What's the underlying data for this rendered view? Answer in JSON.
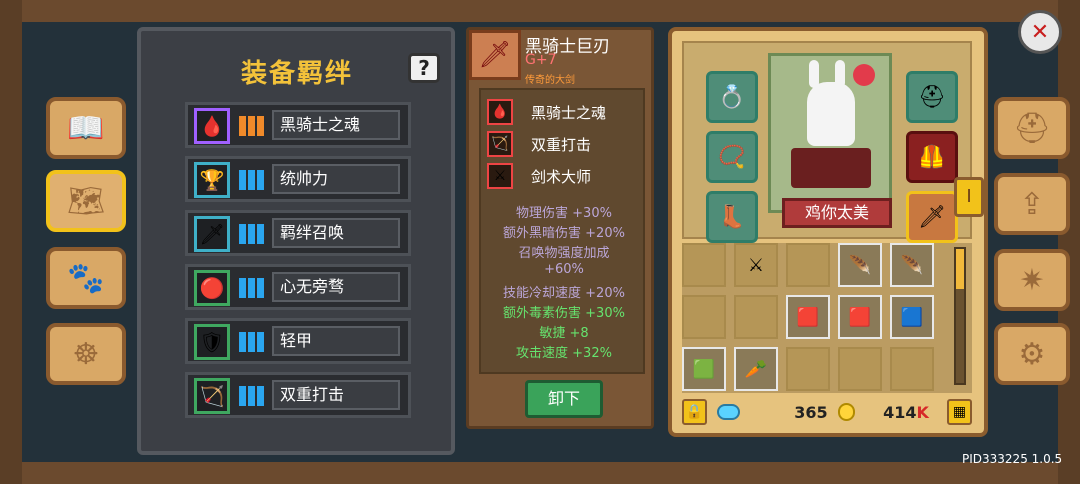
{
  "left_tabs": [
    {
      "name": "book-tab",
      "icon": "book-icon",
      "glyph": "📖",
      "active": false
    },
    {
      "name": "bond-tab",
      "icon": "scroll-icon",
      "glyph": "🗺",
      "active": true
    },
    {
      "name": "pet-tab",
      "icon": "paw-icon",
      "glyph": "🐾",
      "active": false
    },
    {
      "name": "wheel-tab",
      "icon": "wheel-icon",
      "glyph": "☸",
      "active": false
    }
  ],
  "bond_panel": {
    "title": "装备羁绊",
    "help_label": "?",
    "rows": [
      {
        "label": "黑骑士之魂",
        "border": "#a060ff",
        "bar_color": "#f08a2a",
        "icon": "🩸",
        "icon_name": "dark-soul-icon"
      },
      {
        "label": "统帅力",
        "border": "#3fb0c8",
        "bar_color": "#2aa6f0",
        "icon": "🏆",
        "icon_name": "trophy-icon"
      },
      {
        "label": "羁绊召唤",
        "border": "#3fb0c8",
        "bar_color": "#2aa6f0",
        "icon": "🗡",
        "icon_name": "summon-sword-icon"
      },
      {
        "label": "心无旁骛",
        "border": "#3fa860",
        "bar_color": "#2aa6f0",
        "icon": "🔴",
        "icon_name": "focus-icon"
      },
      {
        "label": "轻甲",
        "border": "#3fa860",
        "bar_color": "#2aa6f0",
        "icon": "🛡",
        "icon_name": "light-armor-icon"
      },
      {
        "label": "双重打击",
        "border": "#3fa860",
        "bar_color": "#2aa6f0",
        "icon": "🏹",
        "icon_name": "double-strike-icon"
      }
    ]
  },
  "weapon": {
    "name": "黑骑士巨刃",
    "grade": "G+7",
    "subtitle": "传奇的大剑",
    "skills": [
      {
        "label": "黑骑士之魂",
        "icon": "🩸",
        "icon_name": "dark-soul-icon"
      },
      {
        "label": "双重打击",
        "icon": "🏹",
        "icon_name": "double-strike-icon"
      },
      {
        "label": "剑术大师",
        "icon": "⚔",
        "icon_name": "sword-master-icon"
      }
    ],
    "stats": [
      {
        "text": "物理伤害 +30%",
        "green": false
      },
      {
        "text": "额外黑暗伤害 +20%",
        "green": false
      },
      {
        "text": "召唤物强度加成",
        "green": false
      },
      {
        "text": "+60%",
        "green": false
      },
      {
        "text": "技能冷却速度 +20%",
        "green": false
      },
      {
        "text": "额外毒素伤害 +30%",
        "green": true
      },
      {
        "text": "敏捷 +8",
        "green": true
      },
      {
        "text": "攻击速度 +32%",
        "green": true
      }
    ],
    "unequip_label": "卸下"
  },
  "character": {
    "name": "鸡你太美",
    "equip_slots": [
      {
        "name": "ring-slot",
        "glyph": "💍"
      },
      {
        "name": "helmet-slot",
        "glyph": "⛑"
      },
      {
        "name": "amulet-slot",
        "glyph": "📿"
      },
      {
        "name": "armor-slot",
        "glyph": "🦺"
      },
      {
        "name": "boots-slot",
        "glyph": "👢"
      },
      {
        "name": "weapon-slot",
        "glyph": "🗡"
      }
    ],
    "inventory": [
      {
        "name": "inv-sword-locked",
        "glyph": "⚔",
        "filled": false
      },
      {
        "name": "inv-feather-1",
        "glyph": "🪶",
        "filled": true
      },
      {
        "name": "inv-feather-2",
        "glyph": "🪶",
        "filled": true
      },
      {
        "name": "inv-red-card-1",
        "glyph": "🟥",
        "filled": true
      },
      {
        "name": "inv-red-card-2",
        "glyph": "🟥",
        "filled": true
      },
      {
        "name": "inv-blue-card",
        "glyph": "🟦",
        "filled": true
      },
      {
        "name": "inv-green-card",
        "glyph": "🟩",
        "filled": true
      },
      {
        "name": "inv-carrot",
        "glyph": "🥕",
        "filled": true
      }
    ],
    "gems": "365",
    "coins": "414",
    "coin_suffix": "K",
    "arrow_tab": "I"
  },
  "right_tabs": [
    {
      "name": "helmet-tab",
      "icon": "helmet-icon",
      "glyph": "⛑"
    },
    {
      "name": "upgrade-tab",
      "icon": "upgrade-icon",
      "glyph": "⇪"
    },
    {
      "name": "skill-tab",
      "icon": "compass-icon",
      "glyph": "✷"
    },
    {
      "name": "settings-tab",
      "icon": "gear-icon",
      "glyph": "⚙"
    }
  ],
  "close_glyph": "✕",
  "pid_text": "PID333225 1.0.5"
}
